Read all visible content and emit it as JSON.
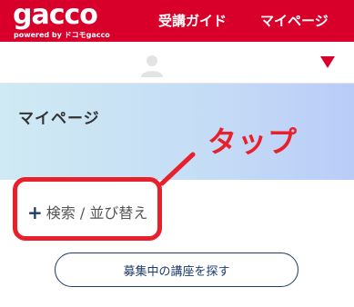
{
  "header": {
    "logo": "gacco",
    "logo_sub": "powered by ドコモgacco",
    "nav_guide": "受講ガイド",
    "nav_mypage": "マイページ"
  },
  "user_bar": {
    "avatar_icon": "user-silhouette-icon",
    "dropdown_icon": "triangle-down-icon"
  },
  "hero": {
    "title": "マイページ"
  },
  "annotation": {
    "label": "タップ"
  },
  "controls": {
    "search_sort_icon": "plus-icon",
    "search_sort_label": "検索 / 並び替え",
    "find_courses_label": "募集中の講座を探す"
  },
  "colors": {
    "brand_red": "#d8002b",
    "annotation_red": "#e8202c",
    "navy": "#1e3a6e"
  }
}
